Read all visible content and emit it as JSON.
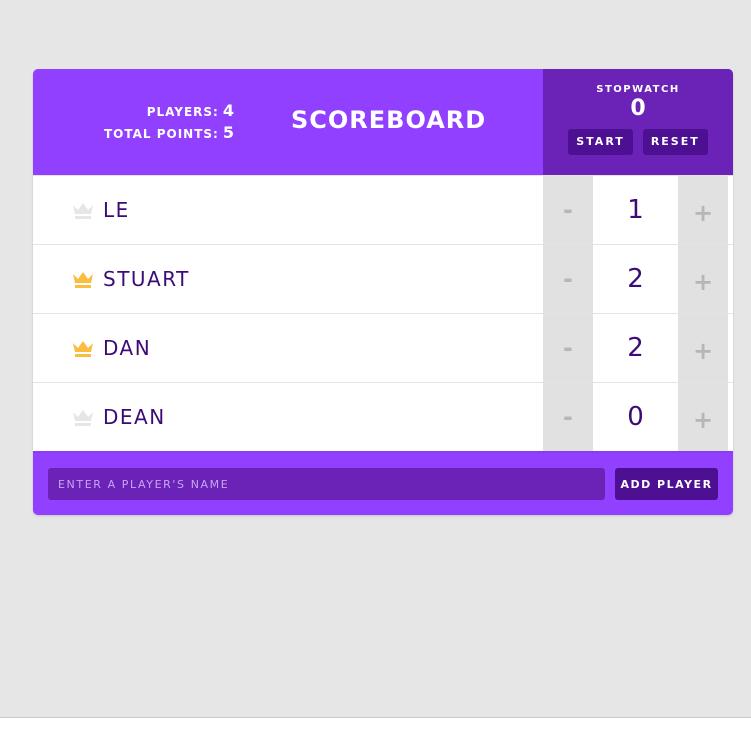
{
  "header": {
    "players_label": "PLAYERS:",
    "players_count": "4",
    "total_points_label": "TOTAL POINTS:",
    "total_points": "5",
    "title": "SCOREBOARD"
  },
  "stopwatch": {
    "label": "STOPWATCH",
    "time": "0",
    "start_label": "START",
    "reset_label": "RESET"
  },
  "players": [
    {
      "name": "LE",
      "score": "1",
      "crown": "crown-icon",
      "leader": false,
      "decrement": "-",
      "increment": "+"
    },
    {
      "name": "STUART",
      "score": "2",
      "crown": "crown-icon",
      "leader": true,
      "decrement": "-",
      "increment": "+"
    },
    {
      "name": "DAN",
      "score": "2",
      "crown": "crown-icon",
      "leader": true,
      "decrement": "-",
      "increment": "+"
    },
    {
      "name": "DEAN",
      "score": "0",
      "crown": "crown-icon",
      "leader": false,
      "decrement": "-",
      "increment": "+"
    }
  ],
  "footer": {
    "input_value": "",
    "input_placeholder": "ENTER A PLAYER'S NAME",
    "add_label": "ADD PLAYER"
  },
  "colors": {
    "header_purple": "#9240ff",
    "stopwatch_purple": "#6a22b7",
    "button_dark_purple": "#4d1093",
    "text_dark_purple": "#3b0c76",
    "crown_gold": "#f9bd40",
    "crown_gray": "#e6e6e6"
  }
}
